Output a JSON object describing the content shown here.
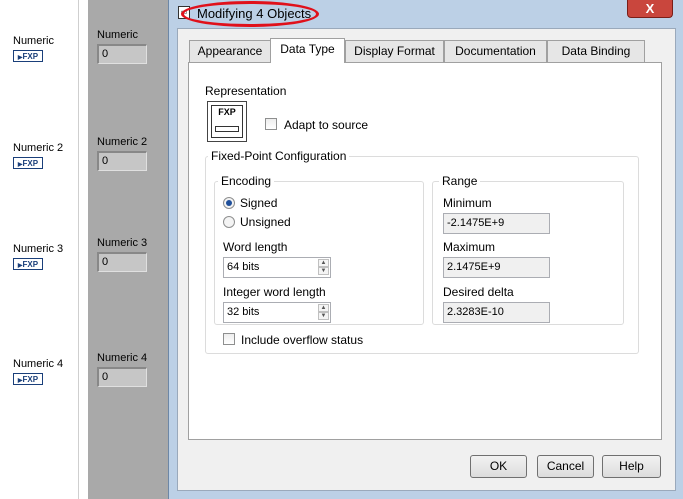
{
  "block_diagram": {
    "terminals": [
      {
        "label": "Numeric",
        "type": "FXP"
      },
      {
        "label": "Numeric 2",
        "type": "FXP"
      },
      {
        "label": "Numeric 3",
        "type": "FXP"
      },
      {
        "label": "Numeric 4",
        "type": "FXP"
      }
    ]
  },
  "front_panel": {
    "controls": [
      {
        "label": "Numeric",
        "value": "0"
      },
      {
        "label": "Numeric 2",
        "value": "0"
      },
      {
        "label": "Numeric 3",
        "value": "0"
      },
      {
        "label": "Numeric 4",
        "value": "0"
      }
    ]
  },
  "dialog": {
    "title": "Modifying 4 Objects",
    "close_symbol": "X",
    "tabs": [
      {
        "label": "Appearance",
        "active": false
      },
      {
        "label": "Data Type",
        "active": true
      },
      {
        "label": "Display Format",
        "active": false
      },
      {
        "label": "Documentation",
        "active": false
      },
      {
        "label": "Data Binding",
        "active": false
      }
    ],
    "representation": {
      "heading": "Representation",
      "icon_text": "FXP",
      "adapt_label": "Adapt to source",
      "adapt_checked": false
    },
    "fixed_point": {
      "heading": "Fixed-Point Configuration",
      "encoding": {
        "heading": "Encoding",
        "signed_label": "Signed",
        "unsigned_label": "Unsigned",
        "selected": "Signed",
        "word_length_label": "Word length",
        "word_length_value": "64 bits",
        "integer_word_length_label": "Integer word length",
        "integer_word_length_value": "32 bits"
      },
      "range": {
        "heading": "Range",
        "minimum_label": "Minimum",
        "minimum_value": "-2.1475E+9",
        "maximum_label": "Maximum",
        "maximum_value": "2.1475E+9",
        "delta_label": "Desired delta",
        "delta_value": "2.3283E-10"
      },
      "overflow_label": "Include overflow status",
      "overflow_checked": false
    },
    "buttons": {
      "ok": "OK",
      "cancel": "Cancel",
      "help": "Help"
    },
    "colors": {
      "highlight_ring": "#e0101a",
      "frame": "#bcd0e6",
      "close": "#c9463d"
    }
  }
}
